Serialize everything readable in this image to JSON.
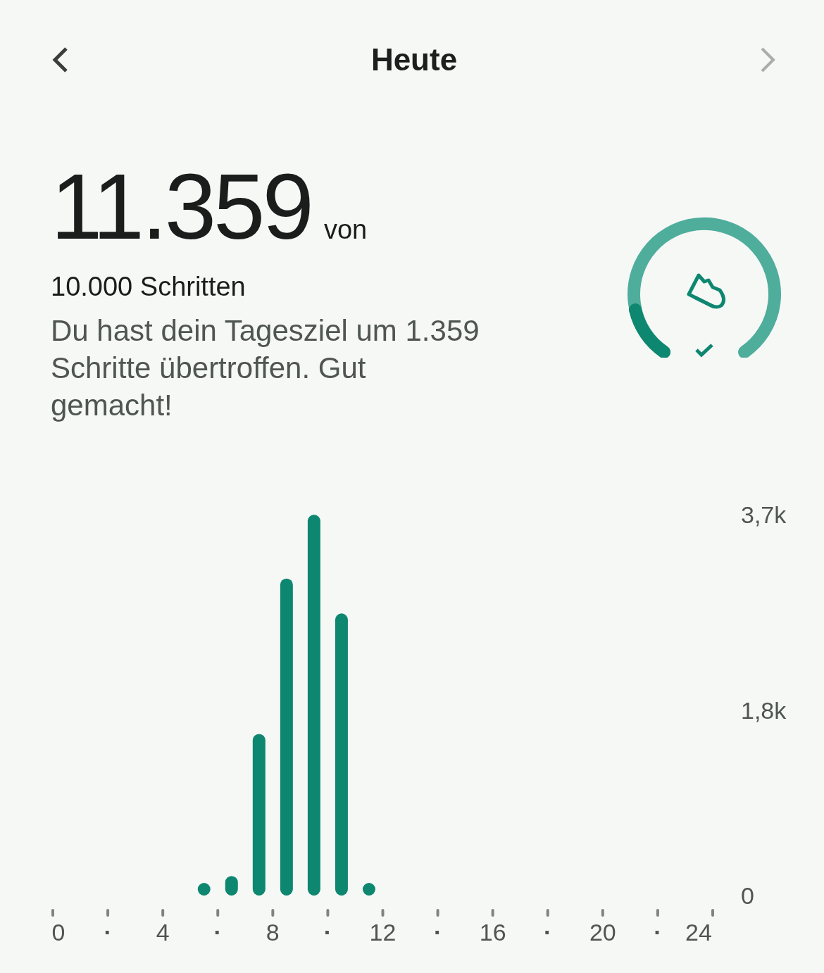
{
  "header": {
    "title": "Heute",
    "back": {
      "disabled": false
    },
    "next": {
      "disabled": true
    }
  },
  "summary": {
    "steps": "11.359",
    "of": "von",
    "goal": "10.000 Schritten",
    "message": "Du hast dein Tagesziel um 1.359 Schritte übertroffen. Gut gemacht!"
  },
  "chart": {
    "chart_data": {
      "type": "bar",
      "x": [
        5.5,
        6.5,
        7.5,
        8.5,
        9.5,
        10.5,
        11.5
      ],
      "values": [
        110,
        190,
        1570,
        3080,
        3700,
        2740,
        110
      ],
      "xlim": [
        0,
        24
      ],
      "ylim": [
        0,
        3700
      ],
      "xticks": [
        {
          "value": 0,
          "label": "0"
        },
        {
          "value": 2,
          "label": "·"
        },
        {
          "value": 4,
          "label": "4"
        },
        {
          "value": 6,
          "label": "·"
        },
        {
          "value": 8,
          "label": "8"
        },
        {
          "value": 10,
          "label": "·"
        },
        {
          "value": 12,
          "label": "12"
        },
        {
          "value": 14,
          "label": "·"
        },
        {
          "value": 16,
          "label": "16"
        },
        {
          "value": 18,
          "label": "·"
        },
        {
          "value": 20,
          "label": "20"
        },
        {
          "value": 22,
          "label": "·"
        },
        {
          "value": 24,
          "label": "24"
        }
      ],
      "yticks": [
        {
          "value": 0,
          "label": "0"
        },
        {
          "value": 1800,
          "label": "1,8k"
        },
        {
          "value": 3700,
          "label": "3,7k"
        }
      ]
    }
  }
}
